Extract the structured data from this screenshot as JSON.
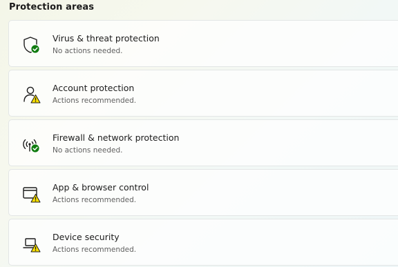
{
  "section_title": "Protection areas",
  "areas": [
    {
      "title": "Virus & threat protection",
      "status": "No actions needed.",
      "icon": "shield-icon",
      "badge": "ok"
    },
    {
      "title": "Account protection",
      "status": "Actions recommended.",
      "icon": "person-icon",
      "badge": "warning"
    },
    {
      "title": "Firewall & network protection",
      "status": "No actions needed.",
      "icon": "wifi-antenna-icon",
      "badge": "ok"
    },
    {
      "title": "App & browser control",
      "status": "Actions recommended.",
      "icon": "browser-window-icon",
      "badge": "warning"
    },
    {
      "title": "Device security",
      "status": "Actions recommended.",
      "icon": "laptop-icon",
      "badge": "warning"
    }
  ],
  "colors": {
    "ok_badge": "#107c10",
    "warning_badge": "#fce100"
  }
}
